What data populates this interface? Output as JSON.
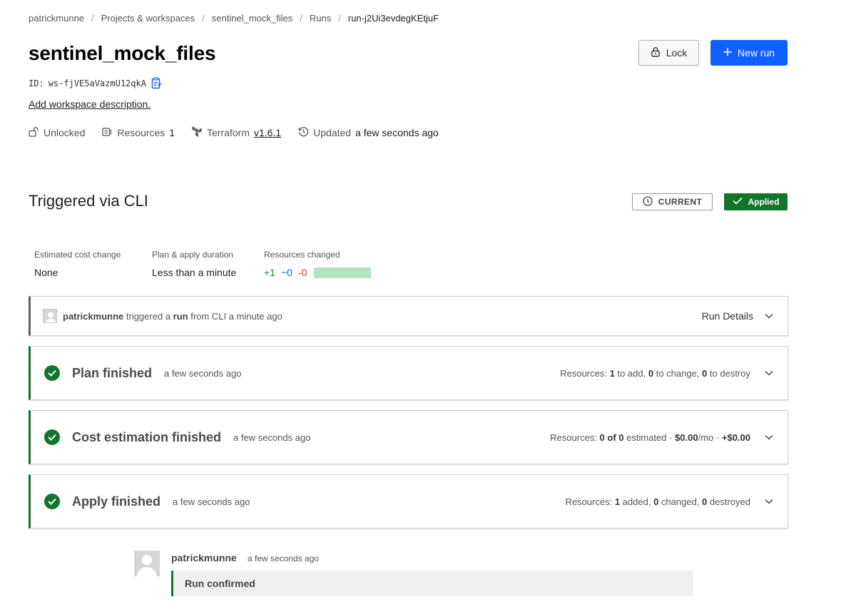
{
  "breadcrumb": {
    "items": [
      "patrickmunne",
      "Projects & workspaces",
      "sentinel_mock_files",
      "Runs"
    ],
    "current": "run-j2Ui3evdegKEtjuF"
  },
  "workspace": {
    "title": "sentinel_mock_files",
    "id_label": "ID:",
    "id_value": "ws-fjVE5aVazmU12qkA",
    "add_description": "Add workspace description."
  },
  "actions": {
    "lock_label": "Lock",
    "new_run_label": "New run"
  },
  "meta": {
    "lock_status": "Unlocked",
    "resources_label": "Resources",
    "resources_count": "1",
    "terraform_label": "Terraform",
    "terraform_version": "v1.6.1",
    "updated_label": "Updated",
    "updated_value": "a few seconds ago"
  },
  "run": {
    "title": "Triggered via CLI",
    "current_badge": "CURRENT",
    "status_badge": "Applied",
    "stats": {
      "cost_label": "Estimated cost change",
      "cost_value": "None",
      "duration_label": "Plan & apply duration",
      "duration_value": "Less than a minute",
      "changed_label": "Resources changed",
      "added": "+1",
      "changed": "~0",
      "destroyed": "-0"
    },
    "trigger": {
      "user": "patrickmunne",
      "text1": "triggered a",
      "run_word": "run",
      "text2": "from CLI a minute ago",
      "details_label": "Run Details"
    },
    "plan": {
      "title": "Plan finished",
      "time": "a few seconds ago",
      "res_label": "Resources:",
      "add_count": "1",
      "add_text": "to add,",
      "change_count": "0",
      "change_text": "to change,",
      "destroy_count": "0",
      "destroy_text": "to destroy"
    },
    "cost": {
      "title": "Cost estimation finished",
      "time": "a few seconds ago",
      "res_label": "Resources:",
      "estimated": "0 of 0",
      "estimated_text": "estimated ·",
      "monthly": "$0.00",
      "monthly_suffix": "/mo ·",
      "delta": "+$0.00"
    },
    "apply": {
      "title": "Apply finished",
      "time": "a few seconds ago",
      "res_label": "Resources:",
      "added_count": "1",
      "added_text": "added,",
      "changed_count": "0",
      "changed_text": "changed,",
      "destroyed_count": "0",
      "destroyed_text": "destroyed"
    },
    "comment": {
      "author": "patrickmunne",
      "time": "a few seconds ago",
      "body": "Run confirmed"
    }
  },
  "colors": {
    "primary": "#1060ff",
    "success": "#14742b",
    "add": "#1b8a36",
    "change": "#1060ff",
    "destroy": "#c73a2a"
  }
}
